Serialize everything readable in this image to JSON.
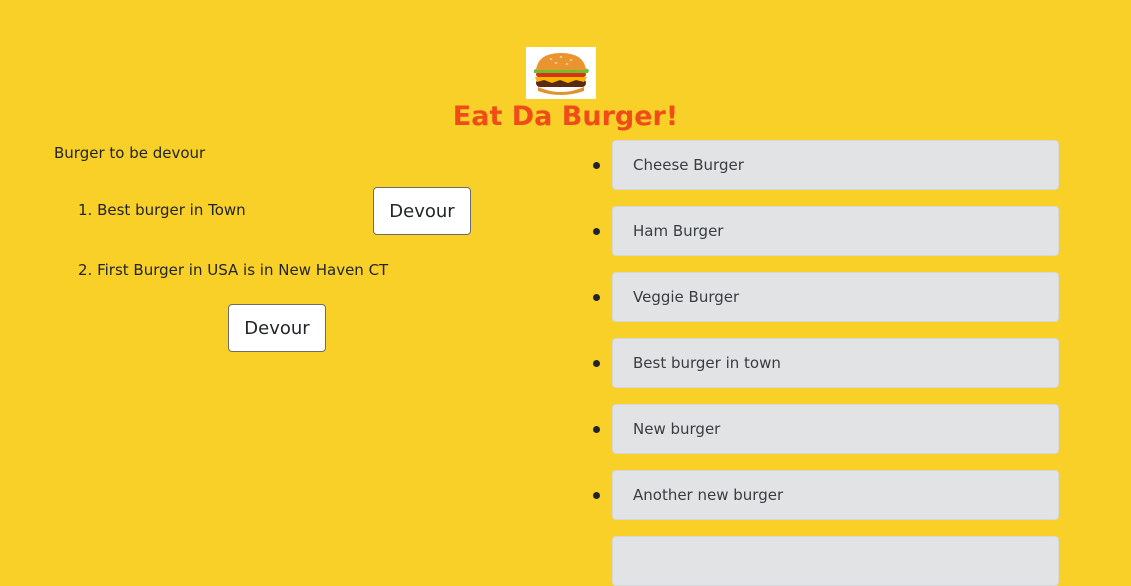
{
  "header": {
    "logo_icon": "burger-icon",
    "title": "Eat Da Burger!"
  },
  "to_devour": {
    "heading": "Burger to be devour",
    "items": [
      {
        "label": "1. Best burger in Town",
        "button": "Devour"
      },
      {
        "label": "2. First Burger in USA is in New Haven CT",
        "button": "Devour"
      }
    ]
  },
  "burgers": [
    "Cheese Burger",
    "Ham Burger",
    "Veggie Burger",
    "Best burger in town",
    "New burger",
    "Another new burger",
    ""
  ],
  "colors": {
    "background": "#f9d027",
    "title": "#f04c19",
    "list_box": "#e2e3e5"
  }
}
